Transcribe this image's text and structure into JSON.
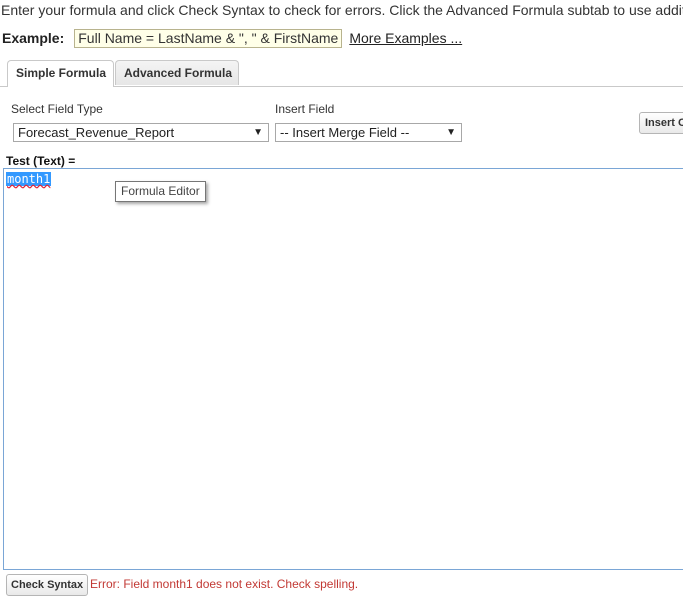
{
  "instructions": "Enter your formula and click Check Syntax to check for errors. Click the Advanced Formula subtab to use additional fie",
  "example": {
    "label": "Example:",
    "formula": "Full Name = LastName & \", \" & FirstName",
    "more_link": "More Examples ..."
  },
  "tabs": [
    {
      "label": "Simple Formula",
      "active": true
    },
    {
      "label": "Advanced Formula",
      "active": false
    }
  ],
  "field_type": {
    "label": "Select Field Type",
    "value": "Forecast_Revenue_Report"
  },
  "insert_field": {
    "label": "Insert Field",
    "value": "-- Insert Merge Field --"
  },
  "insert_button": {
    "label": "Insert O"
  },
  "formula": {
    "title": "Test (Text) =",
    "text": "month1",
    "tooltip": "Formula Editor"
  },
  "check_syntax": {
    "label": "Check Syntax"
  },
  "error": "Error: Field month1 does not exist. Check spelling.",
  "colors": {
    "error": "#c23934",
    "selection": "#3399ff",
    "editor_border": "#7aa6d6"
  }
}
